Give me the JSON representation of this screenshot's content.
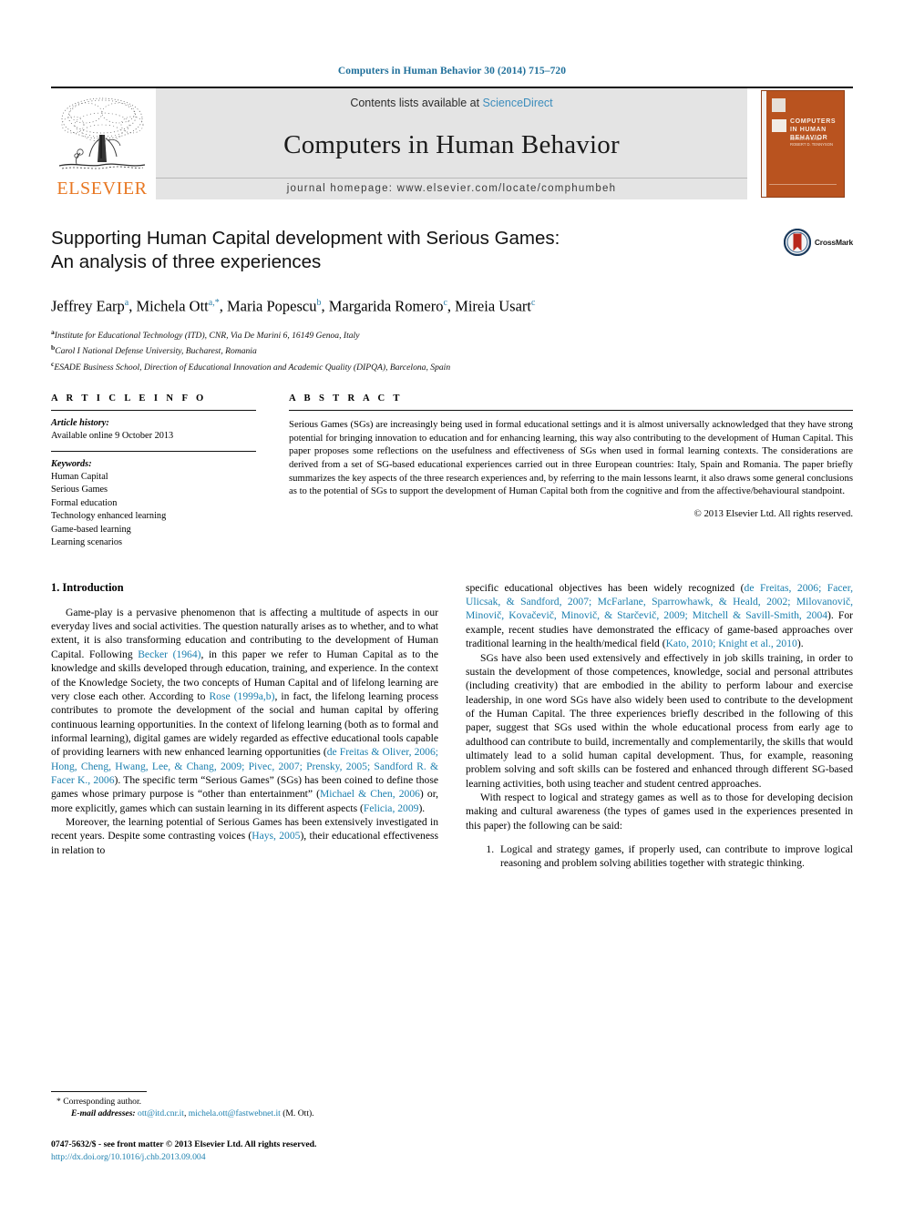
{
  "running_head": "Computers in Human Behavior 30 (2014) 715–720",
  "masthead": {
    "publisher_logo_label": "ELSEVIER",
    "contents_prefix": "Contents lists available at ",
    "contents_link": "ScienceDirect",
    "journal_name": "Computers in Human Behavior",
    "homepage_line": "journal homepage: www.elsevier.com/locate/comphumbeh",
    "cover": {
      "title": "COMPUTERS IN HUMAN BEHAVIOR",
      "subtitle": "EDITOR-IN-CHIEF\nROBERT D. TENNYSON"
    },
    "accent_link_color": "#3c8dbc",
    "brand_orange": "#e87722",
    "cover_color": "#b9531f"
  },
  "article": {
    "title_line_1": "Supporting Human Capital development with Serious Games:",
    "title_line_2": "An analysis of three experiences",
    "crossmark_label": "CrossMark",
    "authors_html": "Jeffrey Earp<sup>a</sup>, Michela Ott<sup>a,*</sup>, Maria Popescu<sup>b</sup>, Margarida Romero<sup>c</sup>, Mireia Usart<sup>c</sup>",
    "affiliations": [
      {
        "marker": "a",
        "text": "Institute for Educational Technology (ITD), CNR, Via De Marini 6, 16149 Genoa, Italy"
      },
      {
        "marker": "b",
        "text": "Carol I National Defense University, Bucharest, Romania"
      },
      {
        "marker": "c",
        "text": "ESADE Business School, Direction of Educational Innovation and Academic Quality (DIPQA), Barcelona, Spain"
      }
    ]
  },
  "article_info": {
    "heading": "A R T I C L E    I N F O",
    "history_label": "Article history:",
    "history_value": "Available online 9 October 2013",
    "keywords_label": "Keywords:",
    "keywords": [
      "Human Capital",
      "Serious Games",
      "Formal education",
      "Technology enhanced learning",
      "Game-based learning",
      "Learning scenarios"
    ]
  },
  "abstract": {
    "heading": "A B S T R A C T",
    "text": "Serious Games (SGs) are increasingly being used in formal educational settings and it is almost universally acknowledged that they have strong potential for bringing innovation to education and for enhancing learning, this way also contributing to the development of Human Capital. This paper proposes some reflections on the usefulness and effectiveness of SGs when used in formal learning contexts. The considerations are derived from a set of SG-based educational experiences carried out in three European countries: Italy, Spain and Romania. The paper briefly summarizes the key aspects of the three research experiences and, by referring to the main lessons learnt, it also draws some general conclusions as to the potential of SGs to support the development of Human Capital both from the cognitive and from the affective/behavioural standpoint.",
    "copyright": "© 2013 Elsevier Ltd. All rights reserved."
  },
  "body": {
    "section_heading": "1. Introduction",
    "left_paragraph_1_html": "Game-play is a pervasive phenomenon that is affecting a multitude of aspects in our everyday lives and social activities. The question naturally arises as to whether, and to what extent, it is also transforming education and contributing to the development of Human Capital. Following <span class=\"cite\">Becker (1964)</span>, in this paper we refer to Human Capital as to the knowledge and skills developed through education, training, and experience. In the context of the Knowledge Society, the two concepts of Human Capital and of lifelong learning are very close each other. According to <span class=\"cite\">Rose (1999a,b)</span>, in fact, the lifelong learning process contributes to promote the development of the social and human capital by offering continuous learning opportunities. In the context of lifelong learning (both as to formal and informal learning), digital games are widely regarded as effective educational tools capable of providing learners with new enhanced learning opportunities (<span class=\"cite\">de Freitas &amp; Oliver, 2006; Hong, Cheng, Hwang, Lee, &amp; Chang, 2009; Pivec, 2007; Prensky, 2005; Sandford R. &amp; Facer K., 2006</span>). The specific term “Serious Games” (SGs) has been coined to define those games whose primary purpose is “other than entertainment” (<span class=\"cite\">Michael &amp; Chen, 2006</span>) or, more explicitly, games which can sustain learning in its different aspects (<span class=\"cite\">Felicia, 2009</span>).",
    "left_paragraph_2_html": "Moreover, the learning potential of Serious Games has been extensively investigated in recent years. Despite some contrasting voices (<span class=\"cite\">Hays, 2005</span>), their educational effectiveness in relation to",
    "right_paragraph_1_html": "specific educational objectives has been widely recognized (<span class=\"cite\">de Freitas, 2006; Facer, Ulicsak, &amp; Sandford, 2007; McFarlane, Sparrowhawk, &amp; Heald, 2002; Milovanovič, Minovič, Kovačevič, Minovič, &amp; Starčevič, 2009; Mitchell &amp; Savill-Smith, 2004</span>). For example, recent studies have demonstrated the efficacy of game-based approaches over traditional learning in the health/medical field (<span class=\"cite\">Kato, 2010; Knight et al., 2010</span>).",
    "right_paragraph_2_html": "SGs have also been used extensively and effectively in job skills training, in order to sustain the development of those competences, knowledge, social and personal attributes (including creativity) that are embodied in the ability to perform labour and exercise leadership, in one word SGs have also widely been used to contribute to the development of the Human Capital. The three experiences briefly described in the following of this paper, suggest that SGs used within the whole educational process from early age to adulthood can contribute to build, incrementally and complementarily, the skills that would ultimately lead to a solid human capital development. Thus, for example, reasoning problem solving and soft skills can be fostered and enhanced through different SG-based learning activities, both using teacher and student centred approaches.",
    "right_paragraph_3_html": "With respect to logical and strategy games as well as to those for developing decision making and cultural awareness (the types of games used in the experiences presented in this paper) the following can be said:",
    "numbered_items": [
      "Logical and strategy games, if properly used, can contribute to improve logical reasoning and problem solving abilities together with strategic thinking."
    ]
  },
  "footnotes": {
    "corresponding_marker": "*",
    "corresponding_text": "Corresponding author.",
    "email_label": "E-mail addresses:",
    "email_1": "ott@itd.cnr.it",
    "email_2": "michela.ott@fastwebnet.it",
    "email_suffix": "(M. Ott)."
  },
  "imprint": {
    "issn_line": "0747-5632/$ - see front matter © 2013 Elsevier Ltd. All rights reserved.",
    "doi_line": "http://dx.doi.org/10.1016/j.chb.2013.09.004"
  }
}
